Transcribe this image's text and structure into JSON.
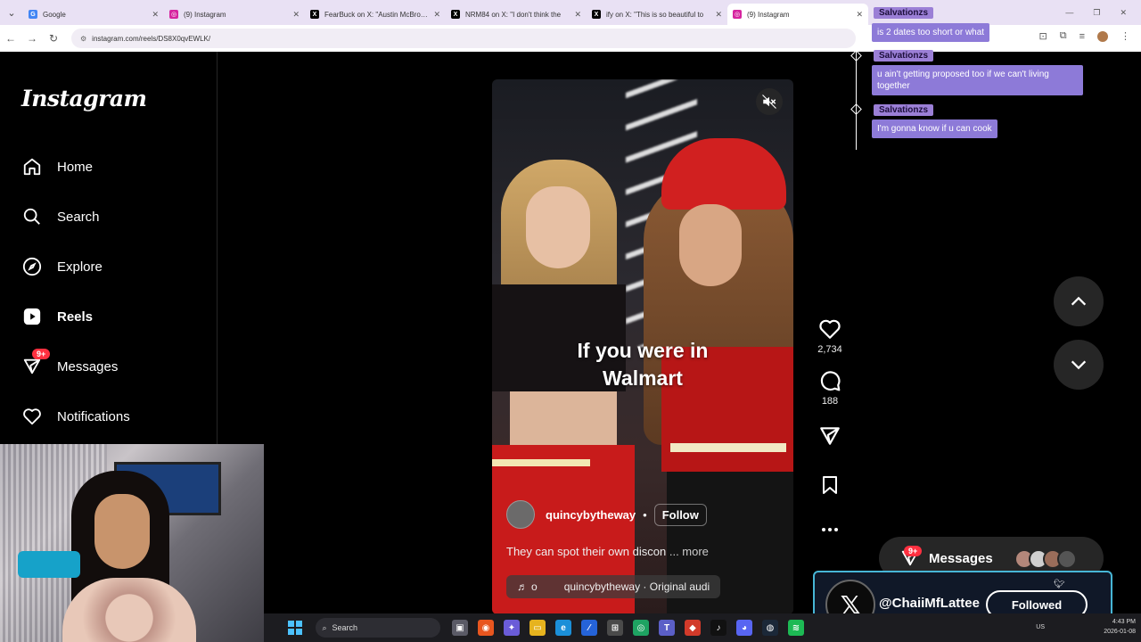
{
  "browser": {
    "tabs": [
      {
        "title": "Google",
        "icon": "G",
        "color": "#4285f4"
      },
      {
        "title": "(9) Instagram",
        "icon": "ig",
        "color": "#d6249f"
      },
      {
        "title": "FearBuck on X: \"Austin McBroom",
        "icon": "X",
        "color": "#000000"
      },
      {
        "title": "NRM84 on X: \"I don't think the",
        "icon": "X",
        "color": "#000000"
      },
      {
        "title": "ify on X: \"This is so beautiful to",
        "icon": "X",
        "color": "#000000"
      },
      {
        "title": "(9) Instagram",
        "icon": "ig",
        "color": "#d6249f"
      }
    ],
    "url": "instagram.com/reels/DS8X0qvEWLK/"
  },
  "sidebar": {
    "logo": "Instagram",
    "items": [
      {
        "label": "Home",
        "icon": "home-icon"
      },
      {
        "label": "Search",
        "icon": "search-icon"
      },
      {
        "label": "Explore",
        "icon": "compass-icon"
      },
      {
        "label": "Reels",
        "icon": "reels-icon"
      },
      {
        "label": "Messages",
        "icon": "messenger-icon",
        "badge": "9+"
      },
      {
        "label": "Notifications",
        "icon": "heart-icon"
      }
    ]
  },
  "reel": {
    "caption_overlay_line1": "If you were in",
    "caption_overlay_line2": "Walmart",
    "author": "quincybytheway",
    "dot": "•",
    "follow_label": "Follow",
    "description": "They can spot their own discon",
    "more_label": "... more",
    "audio_letter": "o",
    "audio_label": "quincybytheway · Original audi",
    "likes": "2,734",
    "comments": "188"
  },
  "chat": [
    {
      "user": "Salvationzs",
      "message": "is 2 dates too short or what"
    },
    {
      "user": "Salvationzs",
      "message": "u ain't getting proposed too if we can't living together"
    },
    {
      "user": "Salvationzs",
      "message": "I'm gonna know if u can cook"
    }
  ],
  "messages_pill": {
    "label": "Messages",
    "badge": "9+"
  },
  "x_overlay": {
    "handle": "@ChaiiMfLattee",
    "button": "Followed"
  },
  "taskbar": {
    "search_label": "Search",
    "lang": "US",
    "time": "4:43 PM",
    "date": "2026-01-08"
  },
  "colors": {
    "accent_chat": "#8d7ad8",
    "badge": "#ff3040",
    "overlay_border": "#47b6d6"
  }
}
